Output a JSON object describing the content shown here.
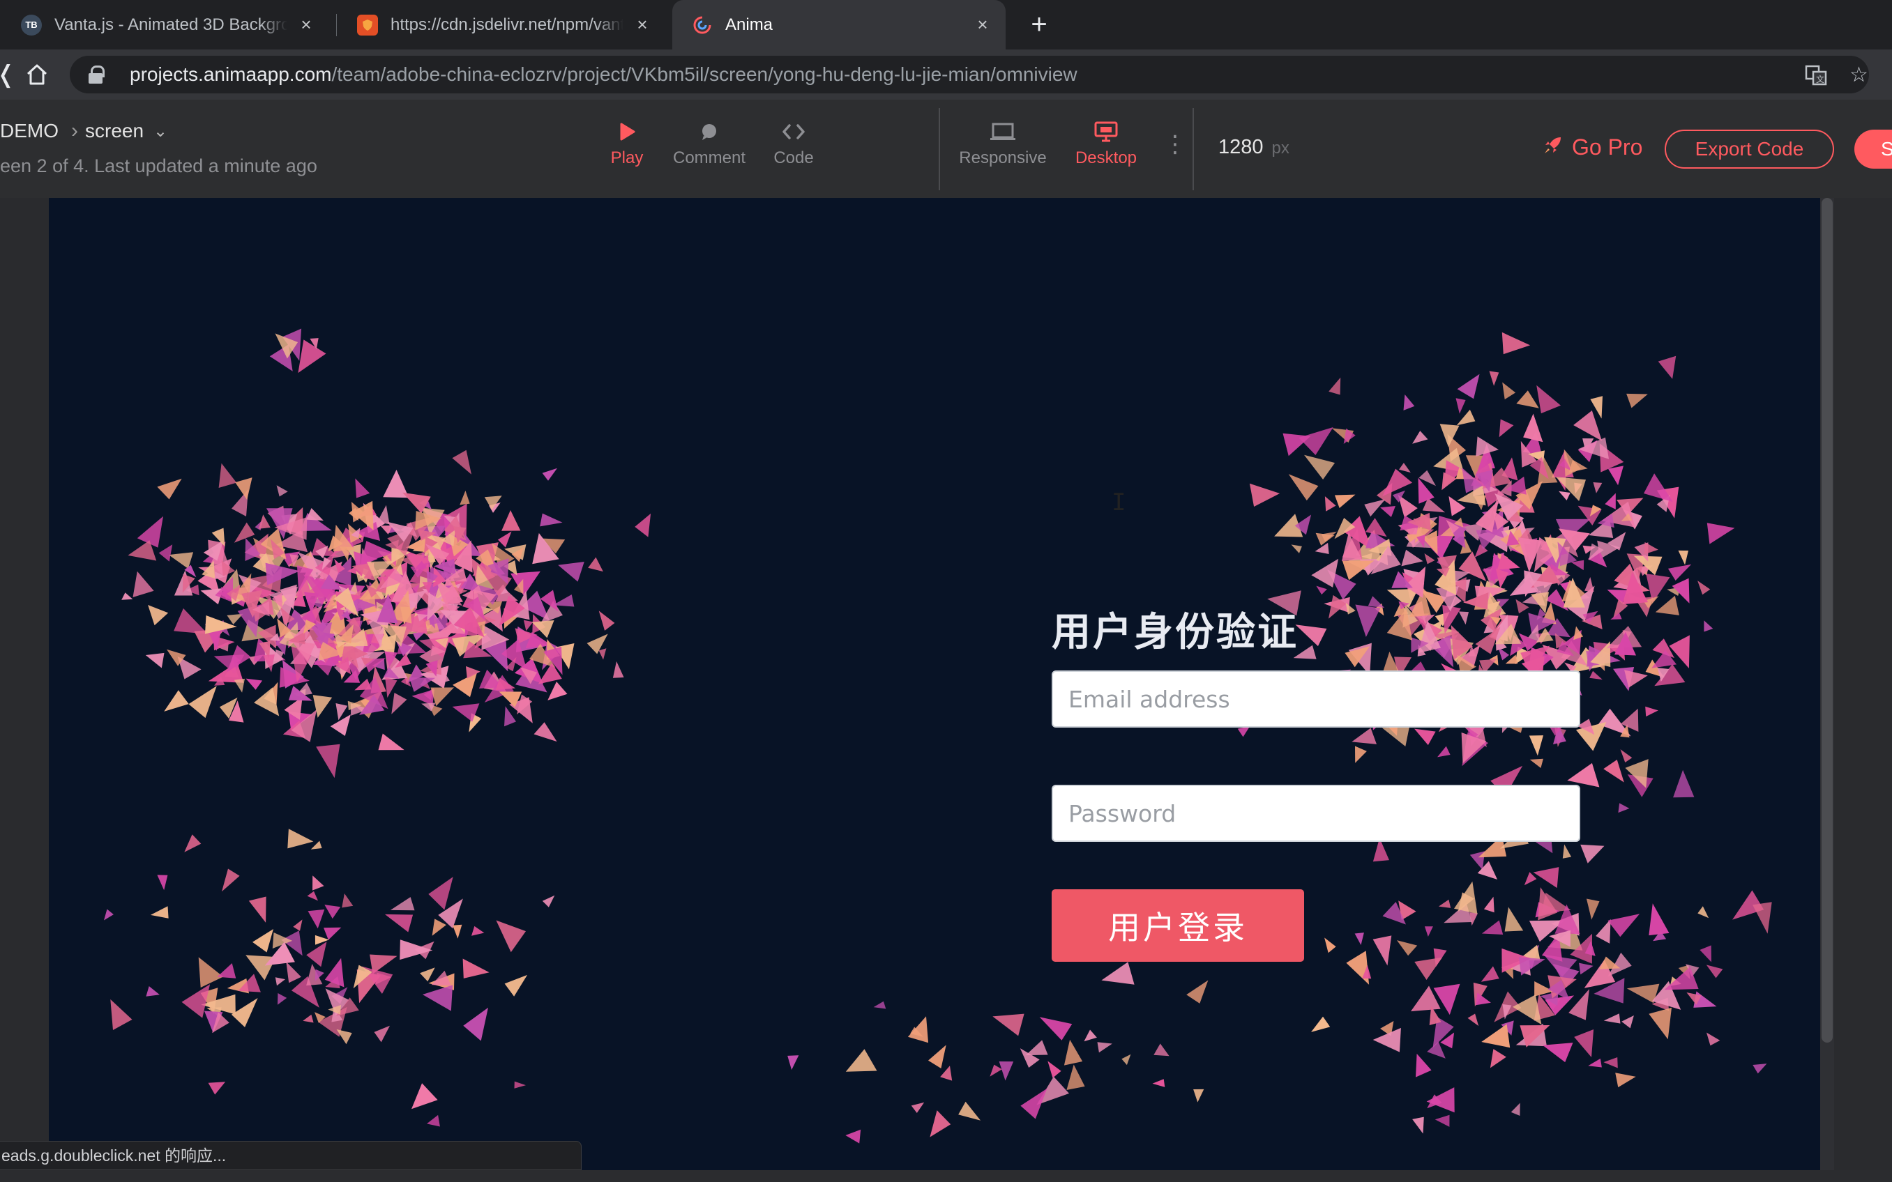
{
  "browser": {
    "tabs": [
      {
        "title": "Vanta.js - Animated 3D Backgrounds",
        "favicon": "TB",
        "active": false
      },
      {
        "title": "https://cdn.jsdelivr.net/npm/vanta",
        "favicon": "shield-icon",
        "active": false
      },
      {
        "title": "Anima",
        "favicon": "anima-logo",
        "active": true
      }
    ],
    "url_host": "projects.animaapp.com",
    "url_path": "/team/adobe-china-eclozrv/project/VKbm5il/screen/yong-hu-deng-lu-jie-mian/omniview",
    "status_text": "eads.g.doubleclick.net 的响应..."
  },
  "anima": {
    "project": "DEMO",
    "screen": "screen",
    "subtitle": "een 2 of 4. Last updated a minute ago",
    "tools": {
      "play": "Play",
      "comment": "Comment",
      "code": "Code"
    },
    "views": {
      "responsive": "Responsive",
      "desktop": "Desktop"
    },
    "width_value": "1280",
    "width_unit": "px",
    "go_pro": "Go Pro",
    "export_code": "Export Code",
    "share_label": "S",
    "accent_color": "#ff5a5f"
  },
  "preview": {
    "background_color": "#081326",
    "title": "用户身份验证",
    "email_placeholder": "Email address",
    "password_placeholder": "Password",
    "login_button": "用户登录",
    "button_color": "#ef5866"
  }
}
